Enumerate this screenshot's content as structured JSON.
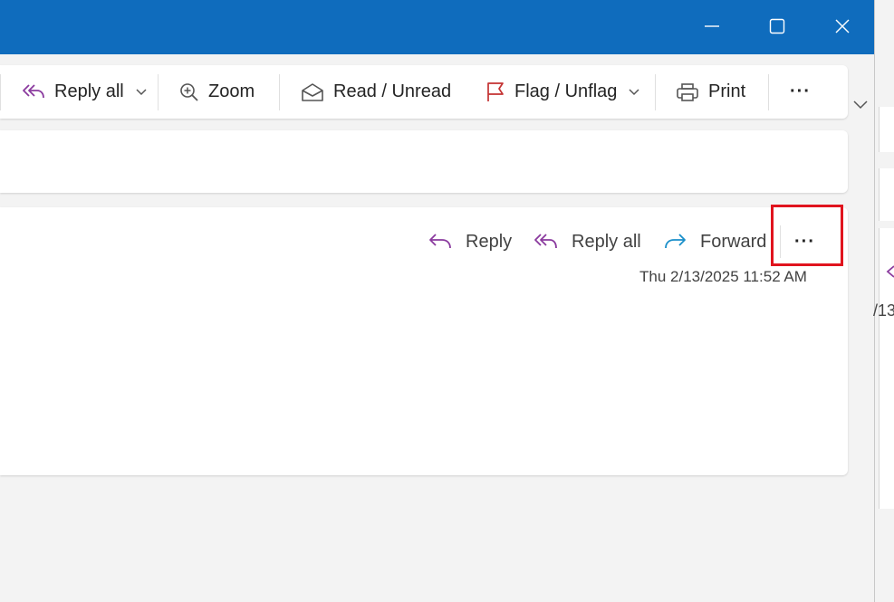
{
  "window": {
    "minimize_icon": "minimize-icon",
    "maximize_icon": "maximize-icon",
    "close_icon": "close-icon",
    "accent_color": "#0f6cbd"
  },
  "toolbar": {
    "reply_all_label": "Reply all",
    "zoom_label": "Zoom",
    "read_unread_label": "Read / Unread",
    "flag_unflag_label": "Flag / Unflag",
    "print_label": "Print",
    "more_label": "···"
  },
  "message": {
    "reply_label": "Reply",
    "reply_all_label": "Reply all",
    "forward_label": "Forward",
    "more_label": "···",
    "timestamp": "Thu 2/13/2025 11:52 AM"
  },
  "right_pane": {
    "partial_text": "/13"
  }
}
